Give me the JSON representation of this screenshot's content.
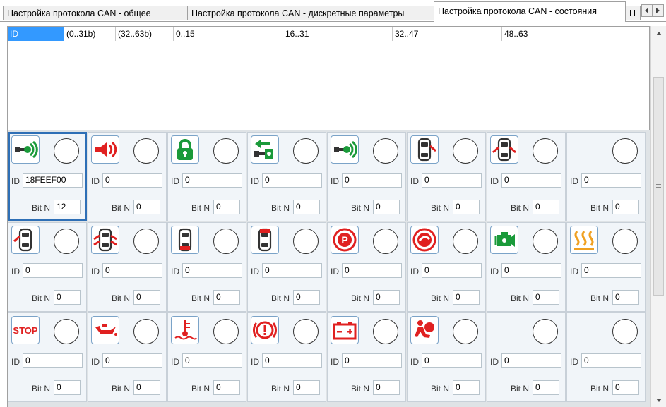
{
  "tabs": [
    {
      "label": "Настройка протокола CAN - общее",
      "active": false
    },
    {
      "label": "Настройка протокола CAN - дискретные параметры",
      "active": false
    },
    {
      "label": "Настройка протокола CAN - состояния",
      "active": true
    },
    {
      "label": "Н",
      "active": false
    }
  ],
  "table": {
    "columns": [
      "ID",
      "(0..31b)",
      "(32..63b)",
      "0..15",
      "16..31",
      "32..47",
      "48..63"
    ],
    "selected_column": "ID"
  },
  "cells": [
    {
      "icon": "cruise-key-icon",
      "id": "18FEEF00",
      "bit": "12",
      "selected": true
    },
    {
      "icon": "horn-icon",
      "id": "0",
      "bit": "0"
    },
    {
      "icon": "lock-icon",
      "id": "0",
      "bit": "0"
    },
    {
      "icon": "key-arrow-icon",
      "id": "0",
      "bit": "0"
    },
    {
      "icon": "cruise-key-icon",
      "id": "0",
      "bit": "0"
    },
    {
      "icon": "car-door-right-open-icon",
      "id": "0",
      "bit": "0"
    },
    {
      "icon": "car-doors-both-open-icon",
      "id": "0",
      "bit": "0"
    },
    {
      "icon": "",
      "id": "0",
      "bit": "0"
    },
    {
      "icon": "car-door-left-open-icon",
      "id": "0",
      "bit": "0"
    },
    {
      "icon": "car-doors-all-open-icon",
      "id": "0",
      "bit": "0"
    },
    {
      "icon": "car-trunk-open-icon",
      "id": "0",
      "bit": "0"
    },
    {
      "icon": "car-hood-open-icon",
      "id": "0",
      "bit": "0"
    },
    {
      "icon": "parking-brake-icon",
      "id": "0",
      "bit": "0"
    },
    {
      "icon": "brake-pad-icon",
      "id": "0",
      "bit": "0"
    },
    {
      "icon": "engine-icon",
      "id": "0",
      "bit": "0"
    },
    {
      "icon": "seat-heater-icon",
      "id": "0",
      "bit": "0"
    },
    {
      "icon": "stop-icon",
      "id": "0",
      "bit": "0",
      "icon_text": "STOP"
    },
    {
      "icon": "oil-can-icon",
      "id": "0",
      "bit": "0"
    },
    {
      "icon": "coolant-temp-icon",
      "id": "0",
      "bit": "0"
    },
    {
      "icon": "brake-warning-icon",
      "id": "0",
      "bit": "0"
    },
    {
      "icon": "battery-icon",
      "id": "0",
      "bit": "0"
    },
    {
      "icon": "airbag-icon",
      "id": "0",
      "bit": "0"
    },
    {
      "icon": "",
      "id": "0",
      "bit": "0"
    },
    {
      "icon": "",
      "id": "0",
      "bit": "0"
    }
  ],
  "labels": {
    "id": "ID",
    "bit": "Bit N"
  },
  "colors": {
    "accent_green": "#1a9a3a",
    "accent_red": "#e02020",
    "selection_blue": "#2e6fb6",
    "header_selected": "#3399ff"
  }
}
